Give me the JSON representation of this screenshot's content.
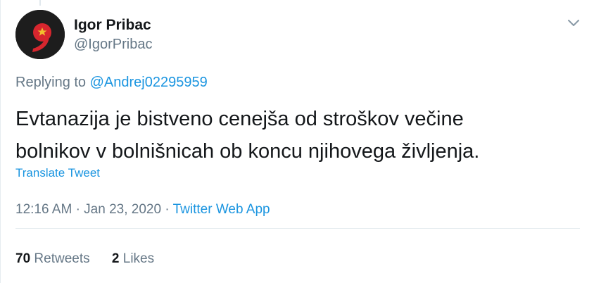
{
  "tweet": {
    "author": {
      "display_name": "Igor Pribac",
      "handle": "@IgorPribac",
      "avatar_icon": "red-nine-logo-icon"
    },
    "replying_to": {
      "prefix": "Replying to",
      "mention": "@Andrej02295959"
    },
    "text_lines": [
      "Evtanazija je bistveno cenejša od stroškov večine",
      "bolnikov v bolnišnicah ob koncu njihovega življenja."
    ],
    "translate_label": "Translate Tweet",
    "time": "12:16 AM",
    "date": "Jan 23, 2020",
    "separator": "·",
    "source": "Twitter Web App",
    "retweets": {
      "count": "70",
      "label": "Retweets"
    },
    "likes": {
      "count": "2",
      "label": "Likes"
    },
    "menu_icon": "chevron-down-icon"
  },
  "colors": {
    "link": "#1b95e0",
    "muted": "#657786",
    "text": "#14171a",
    "divider": "#e6ecf0",
    "avatar_bg": "#1d1d1d",
    "avatar_mark": "#d7262e"
  }
}
